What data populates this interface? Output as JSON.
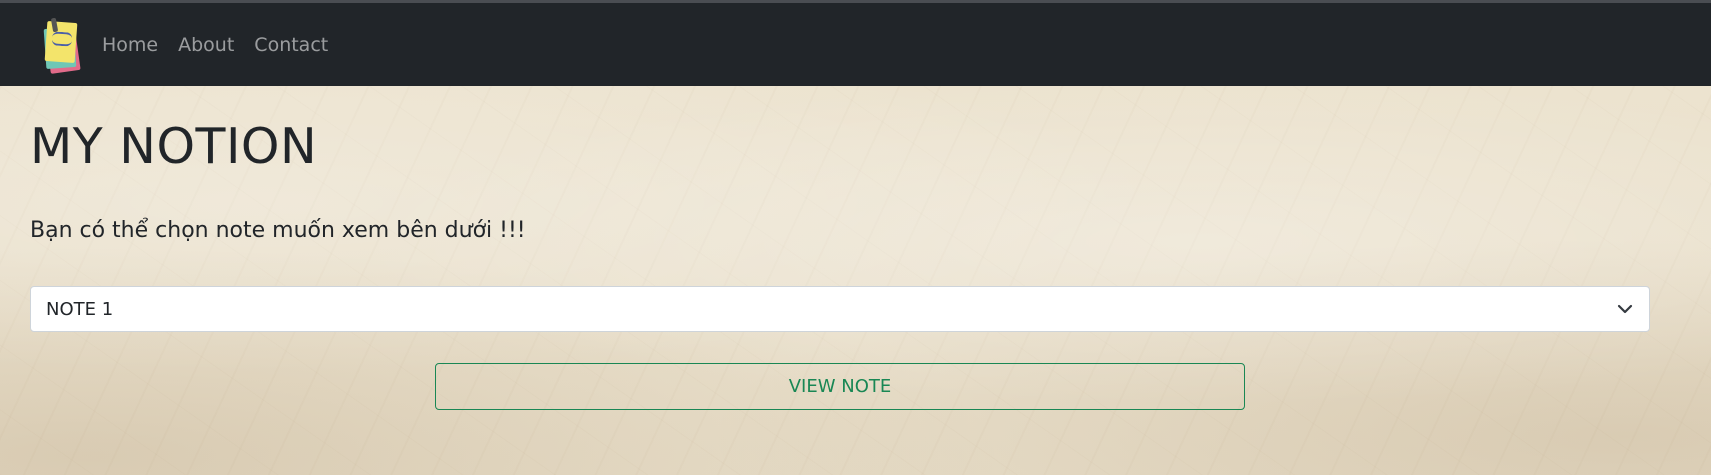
{
  "nav": {
    "items": [
      {
        "label": "Home"
      },
      {
        "label": "About"
      },
      {
        "label": "Contact"
      }
    ]
  },
  "main": {
    "title": "MY NOTION",
    "subtitle": "Bạn có thể chọn note muốn xem bên dưới !!!",
    "select": {
      "selected": "NOTE 1"
    },
    "view_button_label": "VIEW NOTE"
  },
  "colors": {
    "navbar": "#212529",
    "accent": "#198754",
    "background": "#e8dfca"
  },
  "icons": [
    "sticky-notes-logo-icon",
    "chevron-down-icon"
  ]
}
